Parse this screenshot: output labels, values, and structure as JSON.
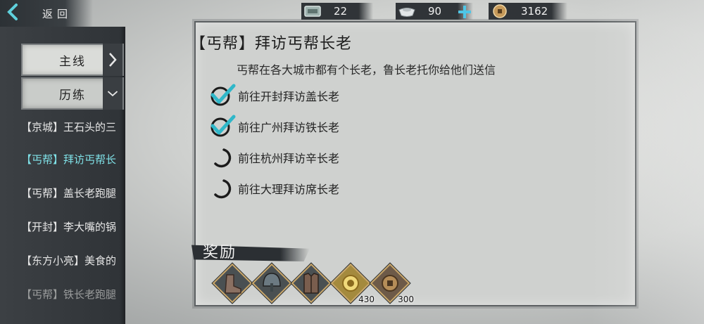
{
  "header": {
    "back_label": "返回",
    "resources": {
      "stamina": {
        "icon": "stamina-icon",
        "value": "22"
      },
      "silver": {
        "icon": "silver-ingot-icon",
        "value": "90"
      },
      "coins": {
        "icon": "copper-coin-icon",
        "value": "3162"
      }
    }
  },
  "sidebar": {
    "categories": [
      {
        "label": "主线",
        "expanded": false
      },
      {
        "label": "历练",
        "expanded": true
      }
    ],
    "quests": [
      {
        "label": "【京城】王石头的三"
      },
      {
        "label": "【丐帮】拜访丐帮长"
      },
      {
        "label": "【丐帮】盖长老跑腿"
      },
      {
        "label": "【开封】李大嘴的锅"
      },
      {
        "label": "【东方小亮】美食的"
      },
      {
        "label": "【丐帮】铁长老跑腿"
      }
    ]
  },
  "quest": {
    "title": "【丐帮】拜访丐帮长老",
    "description": "丐帮在各大城市都有个长老，鲁长老托你给他们送信",
    "steps": [
      {
        "text": "前往开封拜访盖长老",
        "status": "done"
      },
      {
        "text": "前往广州拜访铁长老",
        "status": "done"
      },
      {
        "text": "前往杭州拜访辛长老",
        "status": "pending"
      },
      {
        "text": "前往大理拜访席长老",
        "status": "pending"
      }
    ],
    "reward_label": "奖励",
    "rewards": [
      {
        "icon": "boots-icon",
        "qty": ""
      },
      {
        "icon": "helmet-icon",
        "qty": ""
      },
      {
        "icon": "armor-icon",
        "qty": ""
      },
      {
        "icon": "experience-icon",
        "qty": "430"
      },
      {
        "icon": "copper-coin-icon",
        "qty": "300"
      }
    ]
  },
  "colors": {
    "active_quest": "#7fe0e6",
    "check": "#2fb7c9",
    "panel_dark": "#33373b"
  }
}
